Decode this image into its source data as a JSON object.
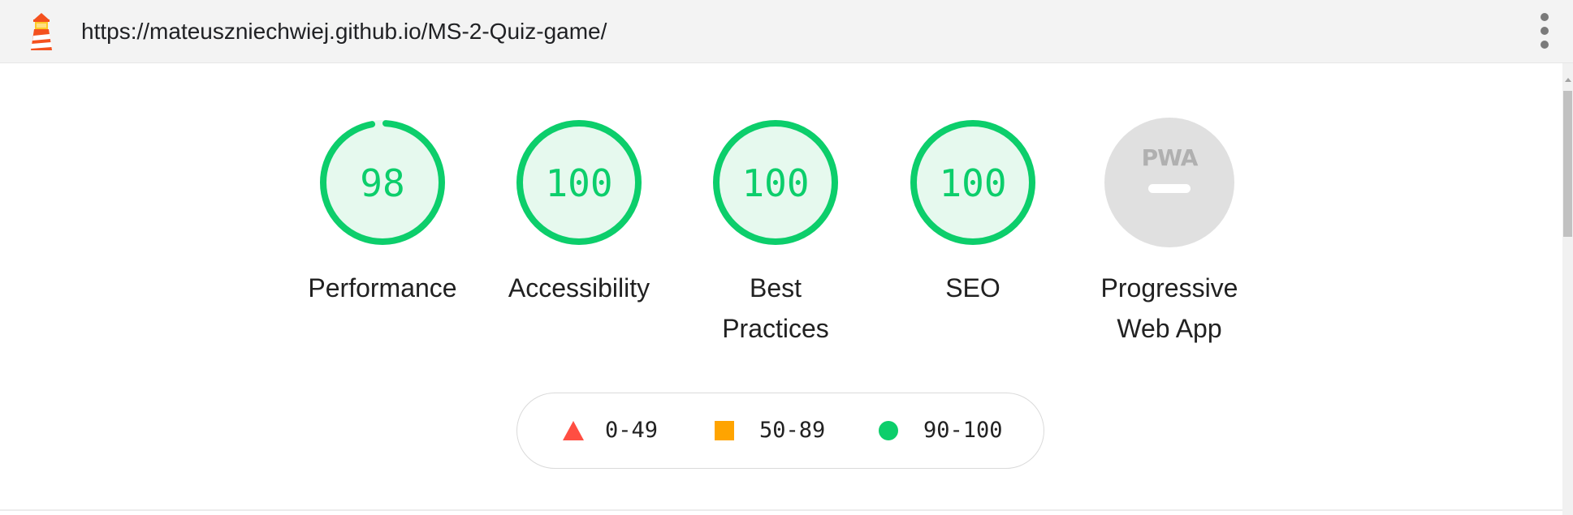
{
  "browser": {
    "url": "https://mateuszniechwiej.github.io/MS-2-Quiz-game/",
    "logo_icon": "lighthouse-icon",
    "menu_icon": "kebab-menu-icon"
  },
  "gauges": [
    {
      "label": "Performance",
      "score": "98",
      "score_value": 98,
      "color": "#0cce6b"
    },
    {
      "label": "Accessibility",
      "score": "100",
      "score_value": 100,
      "color": "#0cce6b"
    },
    {
      "label": "Best Practices",
      "score": "100",
      "score_value": 100,
      "color": "#0cce6b"
    },
    {
      "label": "SEO",
      "score": "100",
      "score_value": 100,
      "color": "#0cce6b"
    },
    {
      "label": "Progressive Web App",
      "badge": "PWA",
      "color": "#cccccc"
    }
  ],
  "legend": [
    {
      "range": "0-49",
      "shape": "triangle",
      "color": "#ff4e42"
    },
    {
      "range": "50-89",
      "shape": "square",
      "color": "#ffa400"
    },
    {
      "range": "90-100",
      "shape": "circle",
      "color": "#0cce6b"
    }
  ]
}
